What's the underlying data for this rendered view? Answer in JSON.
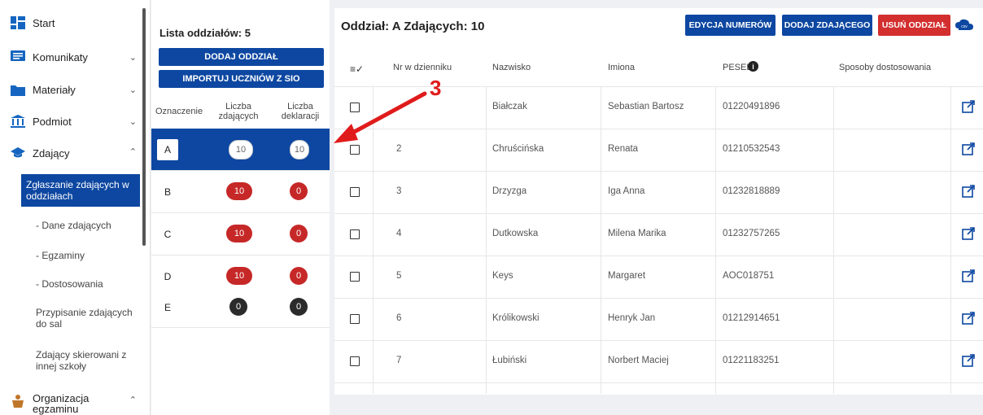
{
  "sidebar": {
    "items": [
      {
        "label": "Start"
      },
      {
        "label": "Komunikaty"
      },
      {
        "label": "Materiały"
      },
      {
        "label": "Podmiot"
      },
      {
        "label": "Zdający"
      }
    ],
    "sub_items": [
      {
        "label": "Zgłaszanie zdających w oddziałach"
      },
      {
        "label": "- Dane zdających"
      },
      {
        "label": "- Egzaminy"
      },
      {
        "label": "- Dostosowania"
      },
      {
        "label": "Przypisanie zdających do sal"
      },
      {
        "label": "Zdający skierowani z innej szkoły"
      }
    ],
    "bottom_item": {
      "label": "Organizacja egzaminu"
    }
  },
  "branches": {
    "title": "Lista oddziałów: 5",
    "add_button": "DODAJ ODDZIAŁ",
    "import_button": "IMPORTUJ UCZNIÓW Z SIO",
    "col_oznaczenie": "Oznaczenie",
    "col_liczba_zdajacych": "Liczba zdających",
    "col_liczba_deklaracji": "Liczba deklaracji",
    "rows": [
      {
        "label": "A",
        "students": "10",
        "declarations": "10"
      },
      {
        "label": "B",
        "students": "10",
        "declarations": "0"
      },
      {
        "label": "C",
        "students": "10",
        "declarations": "0"
      },
      {
        "label": "D",
        "students": "10",
        "declarations": "0"
      },
      {
        "label": "E",
        "students": "0",
        "declarations": "0"
      }
    ]
  },
  "main": {
    "title": "Oddział: A Zdających: 10",
    "btn_edit_numbers": "EDYCJA NUMERÓW",
    "btn_add_student": "DODAJ ZDAJĄCEGO",
    "btn_delete_branch": "USUŃ ODDZIAŁ",
    "csv_label": "csv",
    "columns": {
      "nr": "Nr w dzienniku",
      "surname": "Nazwisko",
      "names": "Imiona",
      "pesel": "PESEL",
      "adjustments": "Sposoby dostosowania"
    },
    "rows": [
      {
        "nr": "",
        "surname": "Białczak",
        "names": "Sebastian Bartosz",
        "pesel": "01220491896"
      },
      {
        "nr": "2",
        "surname": "Chruścińska",
        "names": "Renata",
        "pesel": "01210532543"
      },
      {
        "nr": "3",
        "surname": "Drzyzga",
        "names": "Iga Anna",
        "pesel": "01232818889"
      },
      {
        "nr": "4",
        "surname": "Dutkowska",
        "names": "Milena Marika",
        "pesel": "01232757265"
      },
      {
        "nr": "5",
        "surname": "Keys",
        "names": "Margaret",
        "pesel": "AOC018751"
      },
      {
        "nr": "6",
        "surname": "Królikowski",
        "names": "Henryk Jan",
        "pesel": "01212914651"
      },
      {
        "nr": "7",
        "surname": "Łubiński",
        "names": "Norbert Maciej",
        "pesel": "01221183251"
      }
    ]
  },
  "annotation": {
    "number": "3"
  },
  "colors": {
    "primary": "#0d47a1",
    "danger": "#c62828",
    "dark": "#2b2b2b",
    "annotation": "#e01b1b"
  }
}
